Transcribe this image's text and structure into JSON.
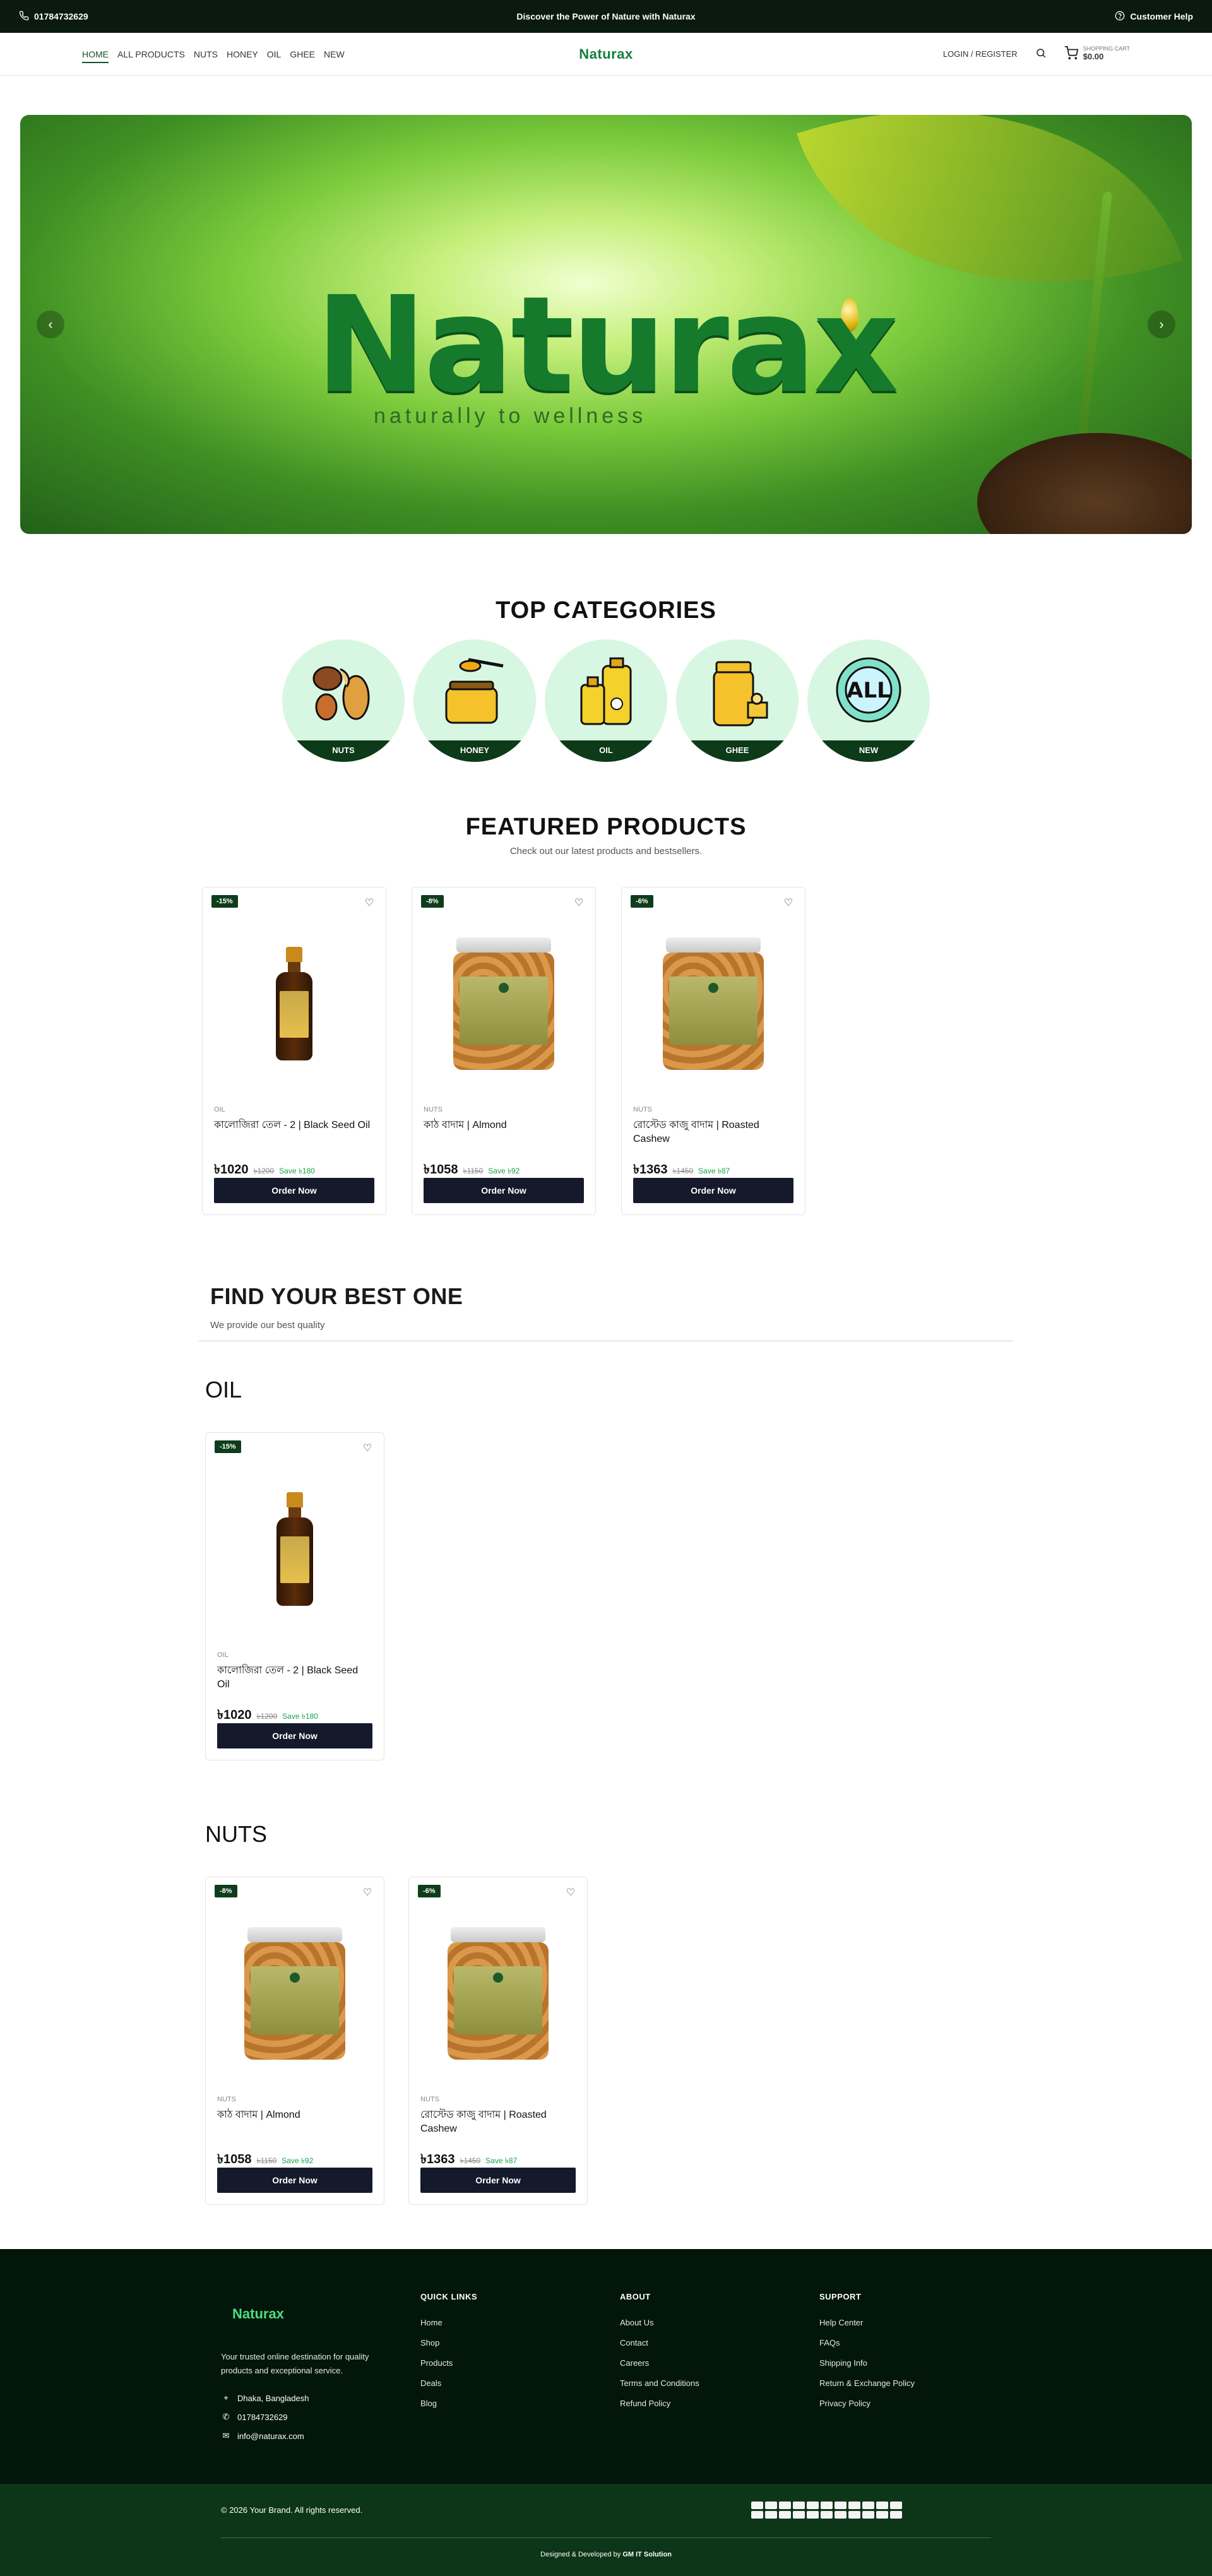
{
  "topbar": {
    "phone": "01784732629",
    "announcement": "Discover the Power of Nature with Naturax",
    "help": "Customer Help"
  },
  "header": {
    "nav": [
      "HOME",
      "ALL PRODUCTS",
      "NUTS",
      "HONEY",
      "OIL",
      "GHEE",
      "NEW"
    ],
    "logo": "Naturax",
    "login": "LOGIN / REGISTER",
    "cart_label": "SHOPPING CART",
    "cart_total": "$0.00"
  },
  "hero": {
    "brand": "Naturax",
    "tagline": "naturally to wellness",
    "prev_icon": "chevron-left-icon",
    "next_icon": "chevron-right-icon"
  },
  "categories": {
    "title": "TOP CATEGORIES",
    "items": [
      "NUTS",
      "HONEY",
      "OIL",
      "GHEE",
      "NEW"
    ]
  },
  "featured": {
    "title": "FEATURED PRODUCTS",
    "subtitle": "Check out our latest products and bestsellers."
  },
  "products": [
    {
      "badge": "-15%",
      "category": "OIL",
      "title": "কালোজিরা তেল - 2 | Black Seed Oil",
      "price": "৳1020",
      "old": "৳1200",
      "save": "Save ৳180",
      "cta": "Order Now",
      "kind": "bottle"
    },
    {
      "badge": "-8%",
      "category": "NUTS",
      "title": "কাঠ বাদাম | Almond",
      "price": "৳1058",
      "old": "৳1150",
      "save": "Save ৳92",
      "cta": "Order Now",
      "kind": "jar"
    },
    {
      "badge": "-6%",
      "category": "NUTS",
      "title": "রোস্টেড কাজু বাদাম | Roasted Cashew",
      "price": "৳1363",
      "old": "৳1450",
      "save": "Save ৳87",
      "cta": "Order Now",
      "kind": "jar"
    }
  ],
  "find": {
    "title": "FIND YOUR BEST ONE",
    "subtitle": "We provide our best quality"
  },
  "sections": {
    "oil": "OIL",
    "nuts": "NUTS"
  },
  "footer": {
    "logo": "Naturax",
    "description": "Your trusted online destination for quality products and exceptional service.",
    "address": "Dhaka, Bangladesh",
    "phone": "01784732629",
    "email": "info@naturax.com",
    "quick_links": {
      "title": "QUICK LINKS",
      "items": [
        "Home",
        "Shop",
        "Products",
        "Deals",
        "Blog"
      ]
    },
    "about": {
      "title": "ABOUT",
      "items": [
        "About Us",
        "Contact",
        "Careers",
        "Terms and Conditions",
        "Refund Policy"
      ]
    },
    "support": {
      "title": "SUPPORT",
      "items": [
        "Help Center",
        "FAQs",
        "Shipping Info",
        "Return & Exchange Policy",
        "Privacy Policy"
      ]
    },
    "copyright": "© 2026 Your Brand. All rights reserved.",
    "developed_prefix": "Designed & Developed by",
    "developer": "GM IT Solution"
  },
  "colors": {
    "topbar_bg": "#0a1a0e",
    "brand_green": "#15803d",
    "button_dark": "#14192b",
    "footer_bg": "#02160a",
    "footer_bottom_bg": "#0d3517",
    "save_green": "#16a34a"
  }
}
